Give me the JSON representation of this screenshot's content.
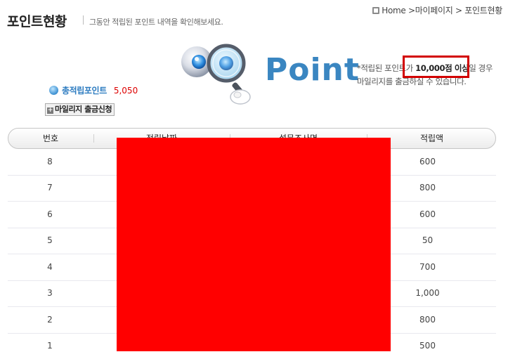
{
  "page": {
    "title": "포인트현황",
    "subtitle": "그동안 적립된 포인트 내역을 확인해보세요."
  },
  "breadcrumb": {
    "home": "Home",
    "sep1": " >",
    "mypage": "마이페이지",
    "sep2": " > ",
    "current": "포인트현황"
  },
  "hero": {
    "word": "Point",
    "notice_prefix": "*적립된 포인트가 ",
    "notice_bold": "10,000점 이상",
    "notice_suffix": "일 경우",
    "notice_line2": "마일리지를 출금하실 수 있습니다."
  },
  "summary": {
    "total_label": "총적립포인트",
    "total_value": "5,050",
    "withdraw_label": "마일리지 출금신청"
  },
  "table": {
    "headers": [
      "번호",
      "적립날짜",
      "설문조사명",
      "적립액"
    ],
    "rows": [
      {
        "no": "8",
        "amount": "600"
      },
      {
        "no": "7",
        "amount": "800"
      },
      {
        "no": "6",
        "amount": "600"
      },
      {
        "no": "5",
        "amount": "50"
      },
      {
        "no": "4",
        "amount": "700"
      },
      {
        "no": "3",
        "amount": "1,000"
      },
      {
        "no": "2",
        "amount": "800"
      },
      {
        "no": "1",
        "amount": "500"
      }
    ]
  },
  "colors": {
    "accent_blue": "#3a86c1",
    "highlight_red": "#d20000",
    "redaction": "#ff0000"
  }
}
